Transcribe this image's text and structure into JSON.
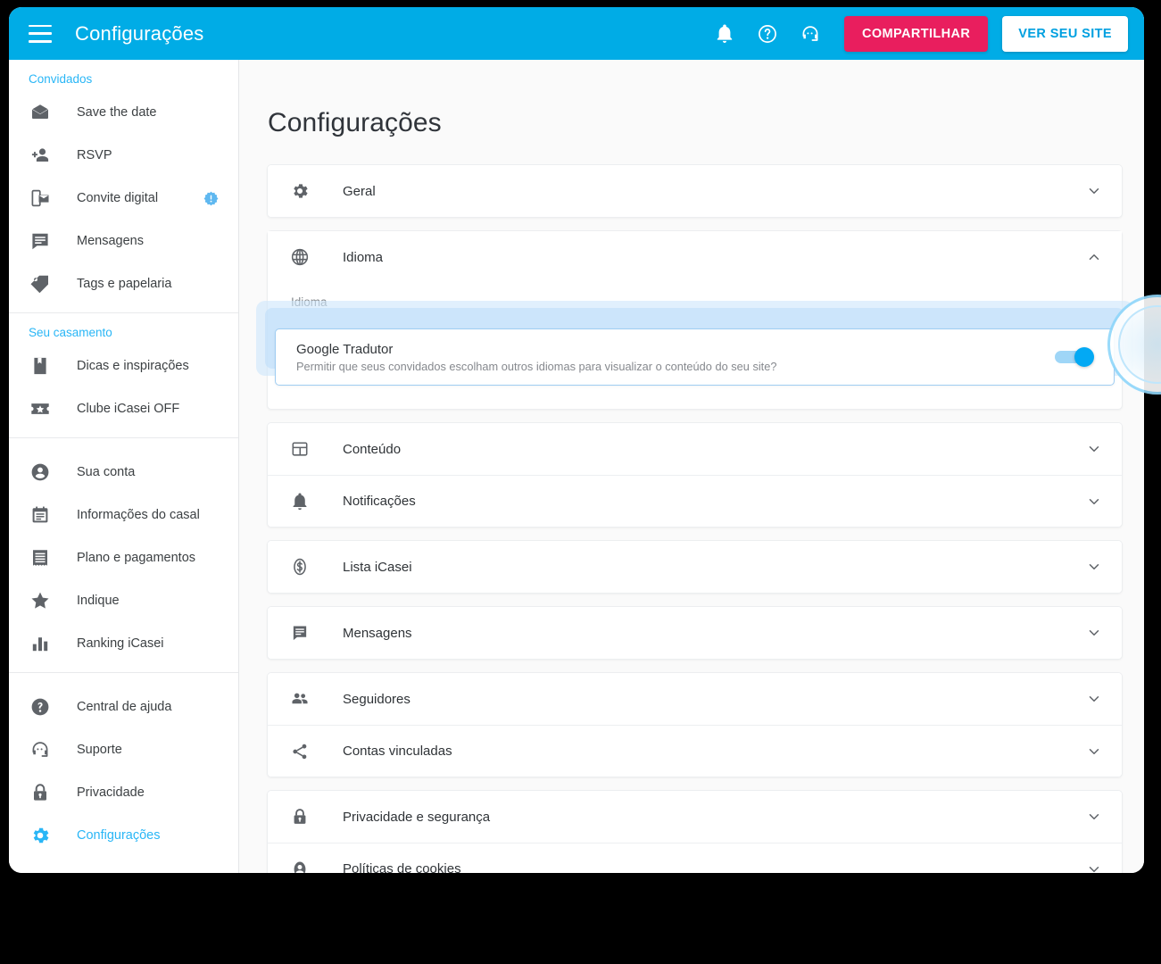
{
  "appbar": {
    "title": "Configurações",
    "menu_icon": "hamburger-icon",
    "notifications_icon": "bell-icon",
    "help_icon": "question-circle-icon",
    "support_icon": "headset-icon",
    "share_label": "COMPARTILHAR",
    "view_site_label": "VER SEU SITE",
    "background_color": "#00ace6",
    "share_color": "#e91e5e",
    "view_site_text_color": "#00a0e0"
  },
  "sidebar": {
    "groups": [
      {
        "heading": "Convidados",
        "items": [
          {
            "label": "Save the date",
            "icon": "envelope-icon",
            "badge": false,
            "active": false
          },
          {
            "label": "RSVP",
            "icon": "person-add-icon",
            "badge": false,
            "active": false
          },
          {
            "label": "Convite digital",
            "icon": "mobile-invite-icon",
            "badge": true,
            "active": false
          },
          {
            "label": "Mensagens",
            "icon": "message-icon",
            "badge": false,
            "active": false
          },
          {
            "label": "Tags e papelaria",
            "icon": "tag-icon",
            "badge": false,
            "active": false
          }
        ]
      },
      {
        "heading": "Seu casamento",
        "items": [
          {
            "label": "Dicas e inspirações",
            "icon": "book-icon",
            "badge": false,
            "active": false
          },
          {
            "label": "Clube iCasei OFF",
            "icon": "ticket-star-icon",
            "badge": false,
            "active": false
          }
        ]
      },
      {
        "heading": "",
        "items": [
          {
            "label": "Sua conta",
            "icon": "account-circle-icon",
            "badge": false,
            "active": false
          },
          {
            "label": "Informações do casal",
            "icon": "calendar-icon",
            "badge": false,
            "active": false
          },
          {
            "label": "Plano e pagamentos",
            "icon": "receipt-icon",
            "badge": false,
            "active": false
          },
          {
            "label": "Indique",
            "icon": "star-icon",
            "badge": false,
            "active": false
          },
          {
            "label": "Ranking iCasei",
            "icon": "bar-chart-icon",
            "badge": false,
            "active": false
          }
        ]
      },
      {
        "heading": "",
        "items": [
          {
            "label": "Central de ajuda",
            "icon": "help-circle-icon",
            "badge": false,
            "active": false
          },
          {
            "label": "Suporte",
            "icon": "headset-icon",
            "badge": false,
            "active": false
          },
          {
            "label": "Privacidade",
            "icon": "lock-icon",
            "badge": false,
            "active": false
          },
          {
            "label": "Configurações",
            "icon": "gear-icon",
            "badge": false,
            "active": true
          }
        ]
      }
    ],
    "heading_color": "#29b6f6",
    "active_color": "#29b6f6"
  },
  "main": {
    "page_title": "Configurações",
    "cards": [
      {
        "rows": [
          {
            "label": "Geral",
            "icon": "gear-icon",
            "expanded": false,
            "chevron": "chevron-down-icon"
          }
        ]
      },
      {
        "expanded_card": true,
        "rows": [
          {
            "label": "Idioma",
            "icon": "globe-icon",
            "expanded": true,
            "chevron": "chevron-up-icon"
          }
        ],
        "body": {
          "section_label": "Idioma",
          "setting": {
            "title": "Google Tradutor",
            "description": "Permitir que seus convidados escolham outros idiomas para visualizar o conteúdo do seu site?",
            "toggle_state": "on",
            "toggle_color": "#03a9f4",
            "highlighted": true
          }
        }
      },
      {
        "rows": [
          {
            "label": "Conteúdo",
            "icon": "layout-icon",
            "expanded": false,
            "chevron": "chevron-down-icon"
          },
          {
            "label": "Notificações",
            "icon": "bell-icon",
            "expanded": false,
            "chevron": "chevron-down-icon"
          }
        ]
      },
      {
        "rows": [
          {
            "label": "Lista iCasei",
            "icon": "money-icon",
            "expanded": false,
            "chevron": "chevron-down-icon"
          }
        ]
      },
      {
        "rows": [
          {
            "label": "Mensagens",
            "icon": "message-icon",
            "expanded": false,
            "chevron": "chevron-down-icon"
          }
        ]
      },
      {
        "rows": [
          {
            "label": "Seguidores",
            "icon": "people-icon",
            "expanded": false,
            "chevron": "chevron-down-icon"
          },
          {
            "label": "Contas vinculadas",
            "icon": "share-icon",
            "expanded": false,
            "chevron": "chevron-down-icon"
          }
        ]
      },
      {
        "rows": [
          {
            "label": "Privacidade e segurança",
            "icon": "lock-icon",
            "expanded": false,
            "chevron": "chevron-down-icon"
          },
          {
            "label": "Políticas de cookies",
            "icon": "account-circle-icon",
            "expanded": false,
            "chevron": "chevron-down-icon"
          }
        ]
      }
    ]
  }
}
